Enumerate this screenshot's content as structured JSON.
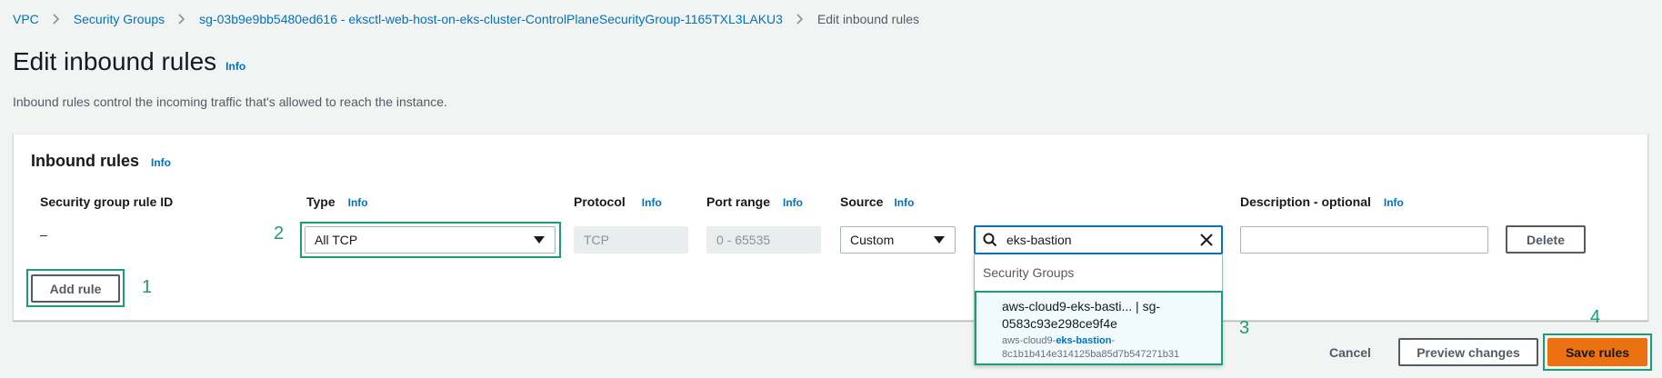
{
  "breadcrumb": {
    "items": [
      "VPC",
      "Security Groups",
      "sg-03b9e9bb5480ed616 - eksctl-web-host-on-eks-cluster-ControlPlaneSecurityGroup-1165TXL3LAKU3"
    ],
    "current": "Edit inbound rules"
  },
  "page": {
    "title": "Edit inbound rules",
    "info": "Info",
    "description": "Inbound rules control the incoming traffic that's allowed to reach the instance."
  },
  "panel": {
    "title": "Inbound rules",
    "info": "Info",
    "columns": {
      "rule_id": "Security group rule ID",
      "type": "Type",
      "protocol": "Protocol",
      "port_range": "Port range",
      "source": "Source",
      "description": "Description - optional"
    },
    "info_label": "Info"
  },
  "rule": {
    "rule_id": "–",
    "type": "All TCP",
    "protocol": "TCP",
    "port_range": "0 - 65535",
    "source_type": "Custom",
    "source_search": "eks-bastion",
    "description": "",
    "delete_label": "Delete"
  },
  "dropdown": {
    "group_label": "Security Groups",
    "option_line1": "aws-cloud9-eks-basti... | sg-",
    "option_line2": "0583c93e298ce9f4e",
    "option_sub_prefix": "aws-cloud9-",
    "option_sub_match": "eks-bastion",
    "option_sub_suffix": "-",
    "option_sub_line2": "8c1b1b414e314125ba85d7b547271b31"
  },
  "actions": {
    "add_rule": "Add rule",
    "cancel": "Cancel",
    "preview": "Preview changes",
    "save": "Save rules"
  },
  "annotations": [
    "1",
    "2",
    "3",
    "4"
  ],
  "colors": {
    "accent": "#ec7211",
    "link": "#0073bb",
    "annotation": "#1b9e77"
  }
}
